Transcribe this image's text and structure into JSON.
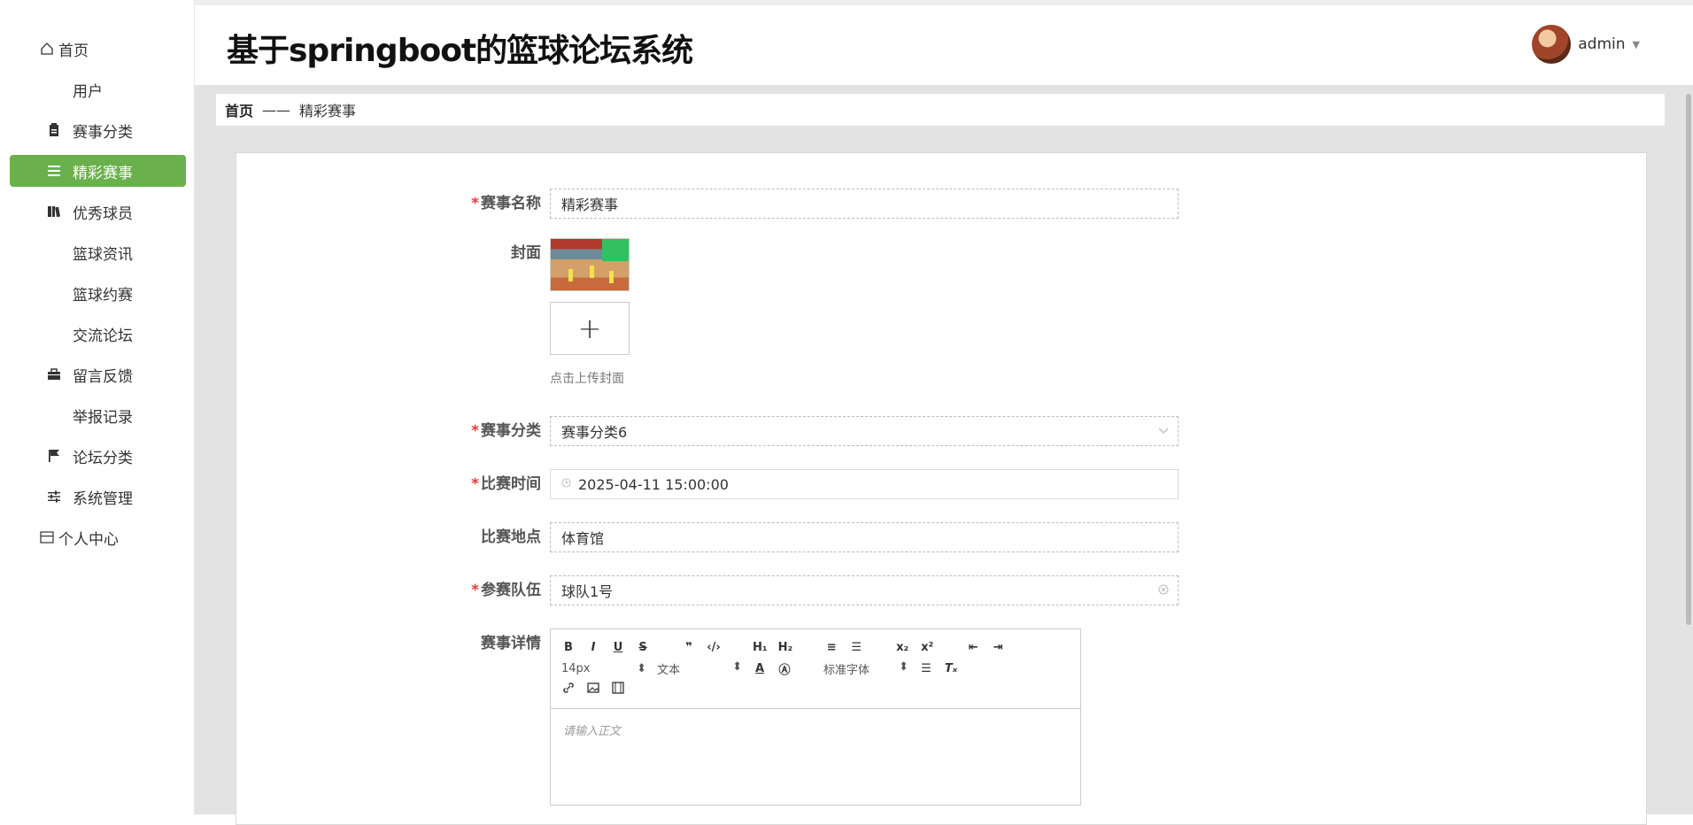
{
  "app": {
    "title": "基于springboot的篮球论坛系统"
  },
  "user": {
    "name": "admin"
  },
  "sidebar": {
    "home": "首页",
    "items": [
      {
        "label": "用户",
        "icon": "grid-icon"
      },
      {
        "label": "赛事分类",
        "icon": "clipboard-icon"
      },
      {
        "label": "精彩赛事",
        "icon": "list-icon",
        "active": true
      },
      {
        "label": "优秀球员",
        "icon": "book-icon"
      },
      {
        "label": "篮球资讯",
        "icon": "grid-icon"
      },
      {
        "label": "篮球约赛",
        "icon": "grid-icon"
      },
      {
        "label": "交流论坛",
        "icon": "grid-icon"
      },
      {
        "label": "留言反馈",
        "icon": "briefcase-icon"
      },
      {
        "label": "举报记录",
        "icon": "grid-icon"
      },
      {
        "label": "论坛分类",
        "icon": "flag-icon"
      },
      {
        "label": "系统管理",
        "icon": "sliders-icon"
      }
    ],
    "personal": "个人中心",
    "active_color": "#6ab04c"
  },
  "breadcrumb": {
    "home": "首页",
    "separator": "——",
    "current": "精彩赛事"
  },
  "form": {
    "name": {
      "label": "赛事名称",
      "value": "精彩赛事",
      "required": true
    },
    "cover": {
      "label": "封面",
      "hint": "点击上传封面",
      "upload_symbol": "+"
    },
    "category": {
      "label": "赛事分类",
      "value": "赛事分类6",
      "required": true
    },
    "time": {
      "label": "比赛时间",
      "value": "2025-04-11 15:00:00",
      "required": true
    },
    "location": {
      "label": "比赛地点",
      "value": "体育馆",
      "required": false
    },
    "team": {
      "label": "参赛队伍",
      "value": "球队1号",
      "required": true
    },
    "detail": {
      "label": "赛事详情",
      "font_size": "14px",
      "text_type": "文本",
      "font_family": "标准字体",
      "placeholder": "请输入正文"
    }
  }
}
